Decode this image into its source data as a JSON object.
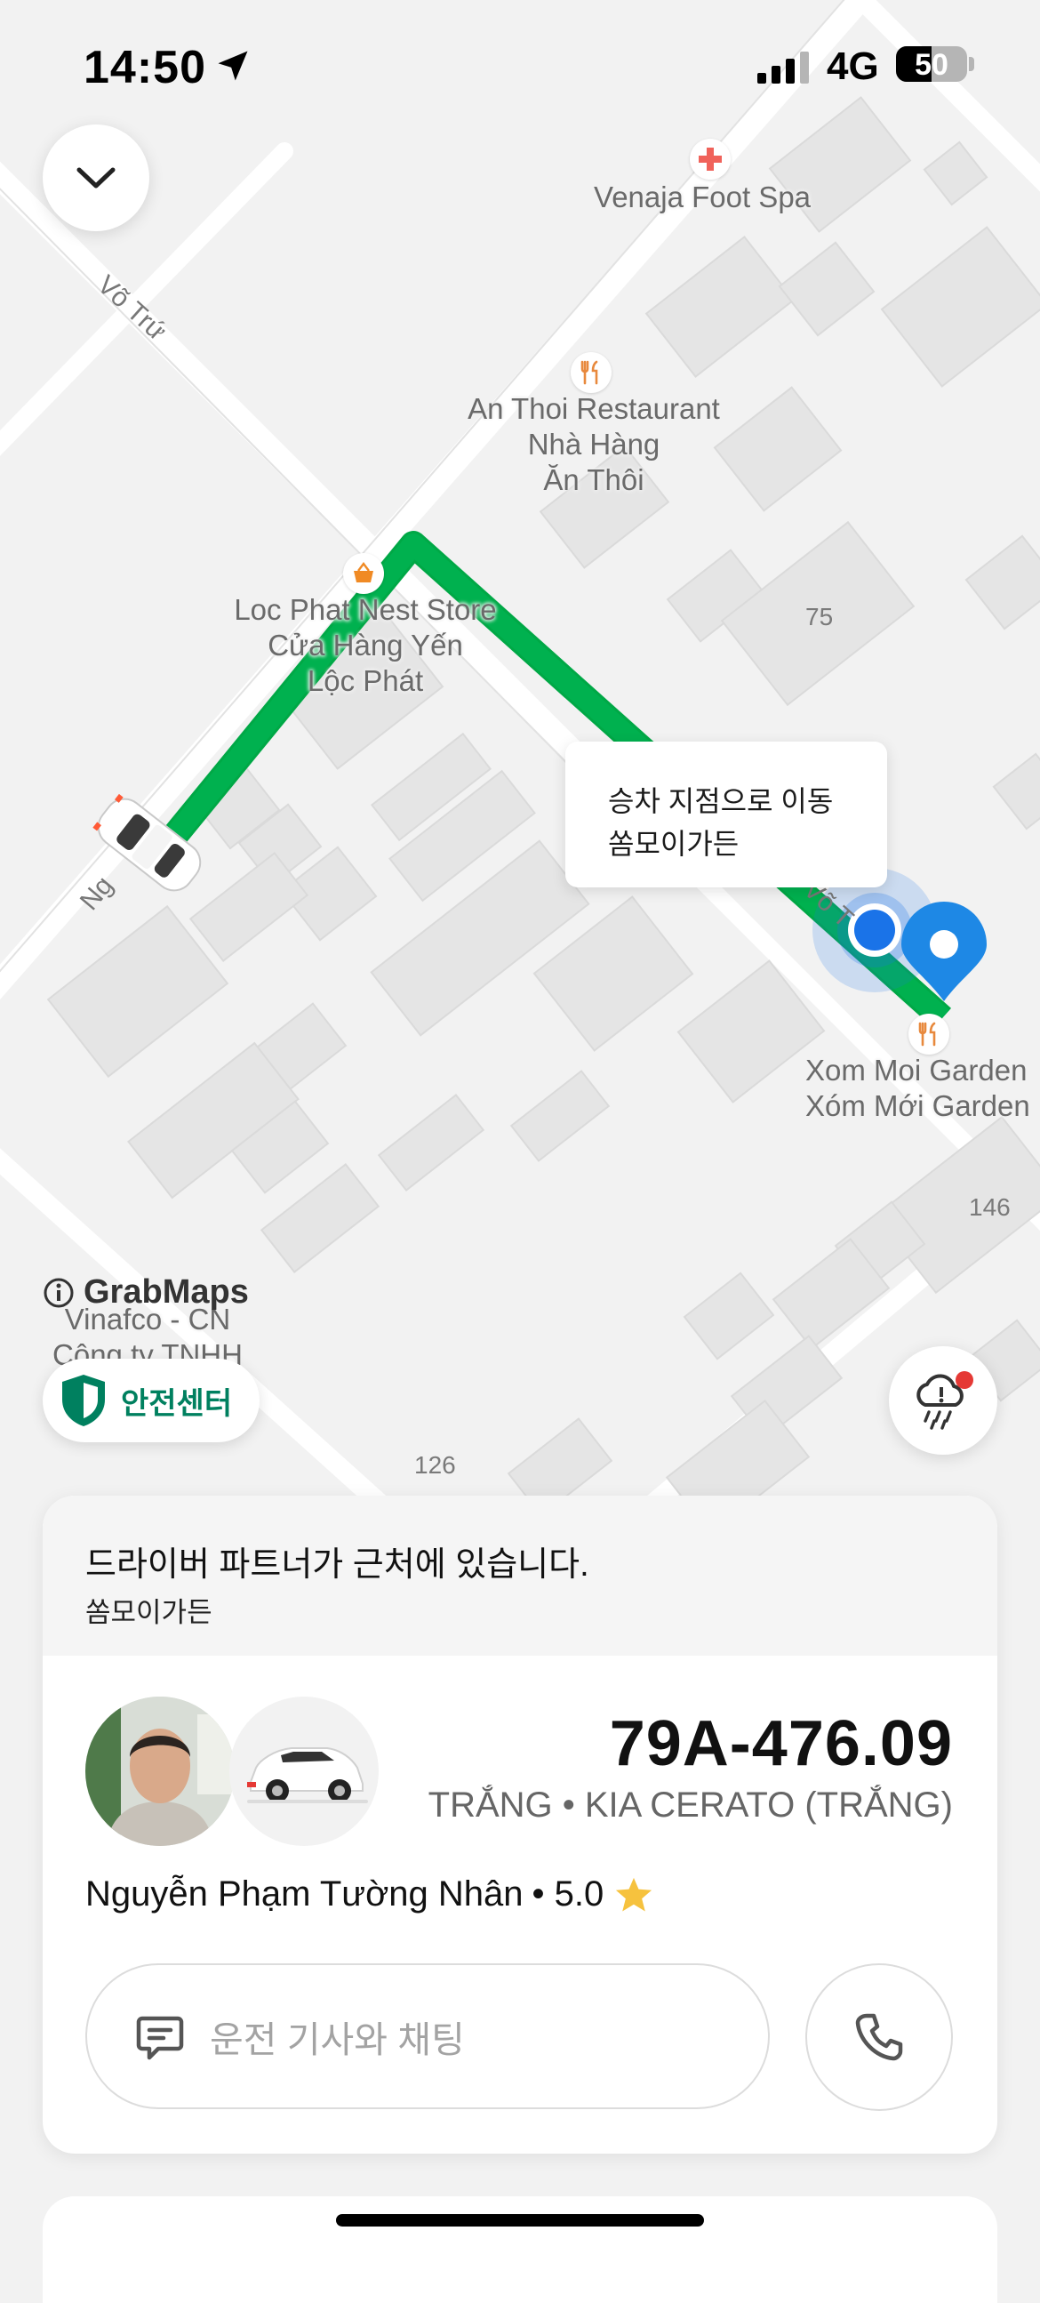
{
  "status_bar": {
    "time": "14:50",
    "network": "4G",
    "battery": "50",
    "battery_level": 0.5
  },
  "map": {
    "pois": [
      {
        "name": "Venaja Foot Spa",
        "icon": "pharmacy-icon"
      },
      {
        "name_lines": [
          "An Thoi Restaurant",
          "Nhà Hàng",
          "Ăn Thôi"
        ],
        "icon": "restaurant-icon"
      },
      {
        "name_lines": [
          "Loc Phat Nest Store",
          "Cửa Hàng Yến",
          "Lộc Phát"
        ],
        "icon": "shopping-basket-icon"
      },
      {
        "name_lines": [
          "Xom Moi Garden",
          "Xóm Mới Garden"
        ],
        "icon": "restaurant-icon"
      },
      {
        "name_lines": [
          "Vinafco - CN",
          "Công ty TNHH"
        ]
      }
    ],
    "streets": [
      "Võ Trứ",
      "Ng",
      "Võ T"
    ],
    "numbers": [
      "75",
      "146",
      "126"
    ],
    "attribution": "GrabMaps",
    "route_color": "#00b14f",
    "user_dot_color": "#1a73e8",
    "pin_color": "#1e88e5"
  },
  "tooltip": {
    "line1": "승차 지점으로 이동",
    "line2": "쏨모이가든"
  },
  "safety_center": {
    "label": "안전센터",
    "icon": "shield-icon",
    "color": "#00805f"
  },
  "weather_alert": {
    "icon": "rain-cloud-alert-icon",
    "badge_color": "#e53935"
  },
  "trip_card": {
    "status": "드라이버 파트너가 근처에 있습니다.",
    "pickup": "쏨모이가든",
    "plate": "79A-476.09",
    "vehicle": "TRẮNG • KIA CERATO (TRẮNG)",
    "driver_name": "Nguyễn Phạm Tường Nhân",
    "rating": "• 5.0",
    "chat_placeholder": "운전 기사와 채팅"
  }
}
